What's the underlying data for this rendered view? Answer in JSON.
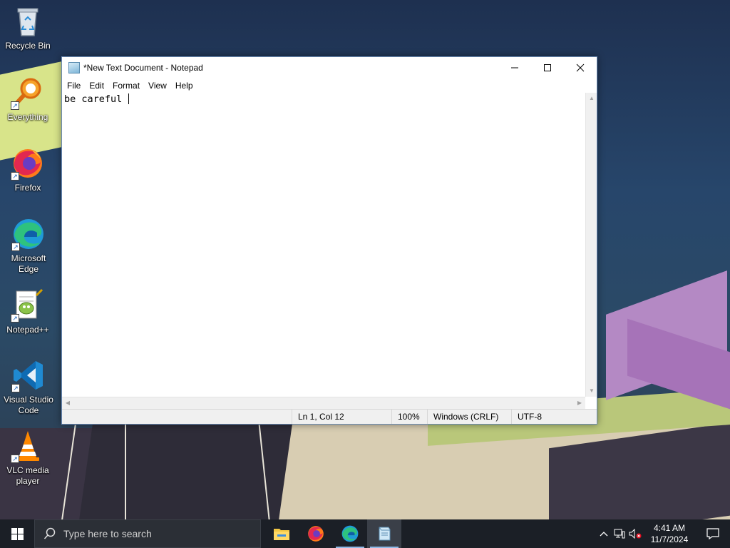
{
  "desktop": {
    "icons": [
      {
        "label": "Recycle Bin",
        "icon": "recycle-bin-icon"
      },
      {
        "label": "Everything",
        "icon": "everything-search-icon"
      },
      {
        "label": "Firefox",
        "icon": "firefox-icon"
      },
      {
        "label": "Microsoft Edge",
        "icon": "edge-icon"
      },
      {
        "label": "Notepad++",
        "icon": "notepad-plus-plus-icon"
      },
      {
        "label": "Visual Studio Code",
        "icon": "vscode-icon"
      },
      {
        "label": "VLC media player",
        "icon": "vlc-icon"
      }
    ]
  },
  "notepad": {
    "title": "*New Text Document - Notepad",
    "menu": [
      "File",
      "Edit",
      "Format",
      "View",
      "Help"
    ],
    "content": "be careful ",
    "status": {
      "position": "Ln 1, Col 12",
      "zoom": "100%",
      "line_endings": "Windows (CRLF)",
      "encoding": "UTF-8"
    }
  },
  "taskbar": {
    "search_placeholder": "Type here to search",
    "apps": [
      "file-explorer-icon",
      "firefox-icon",
      "edge-icon",
      "notepad-icon"
    ],
    "time": "4:41 AM",
    "date": "11/7/2024"
  }
}
